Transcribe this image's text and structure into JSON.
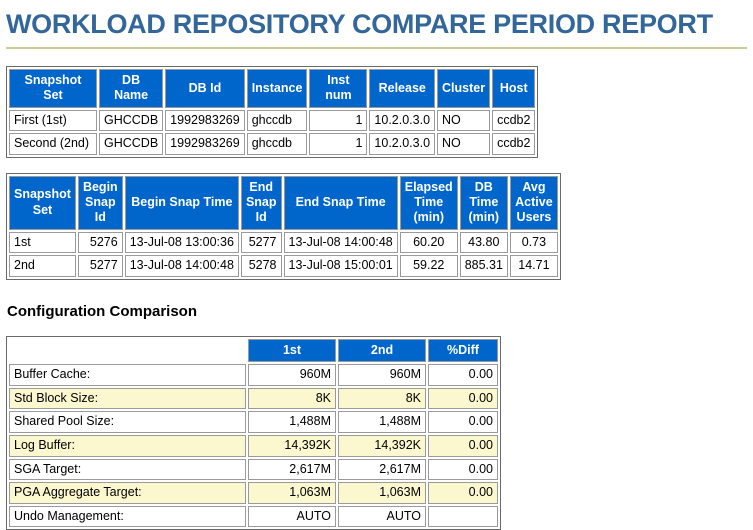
{
  "page": {
    "title": "WORKLOAD REPOSITORY COMPARE PERIOD REPORT"
  },
  "colors": {
    "title_color": "#336699",
    "header_bg": "#0066CC",
    "header_text": "#FFFFFF",
    "alt_row_bg": "#FBF8D0",
    "rule_color": "#CCCC99"
  },
  "tables": {
    "snapshot_info": {
      "headers": [
        "Snapshot Set",
        "DB Name",
        "DB Id",
        "Instance",
        "Inst num",
        "Release",
        "Cluster",
        "Host"
      ],
      "rows": [
        [
          "First (1st)",
          "GHCCDB",
          "1992983269",
          "ghccdb",
          "1",
          "10.2.0.3.0",
          "NO",
          "ccdb2"
        ],
        [
          "Second (2nd)",
          "GHCCDB",
          "1992983269",
          "ghccdb",
          "1",
          "10.2.0.3.0",
          "NO",
          "ccdb2"
        ]
      ]
    },
    "snapshot_details": {
      "headers": [
        "Snapshot Set",
        "Begin Snap Id",
        "Begin Snap Time",
        "End Snap Id",
        "End Snap Time",
        "Elapsed Time (min)",
        "DB Time (min)",
        "Avg Active Users"
      ],
      "rows": [
        [
          "1st",
          "5276",
          "13-Jul-08 13:00:36",
          "5277",
          "13-Jul-08 14:00:48",
          "60.20",
          "43.80",
          "0.73"
        ],
        [
          "2nd",
          "5277",
          "13-Jul-08 14:00:48",
          "5278",
          "13-Jul-08 15:00:01",
          "59.22",
          "885.31",
          "14.71"
        ]
      ]
    },
    "config_comparison": {
      "heading": "Configuration Comparison",
      "headers": [
        "1st",
        "2nd",
        "%Diff"
      ],
      "rows": [
        [
          "Buffer Cache:",
          "960M",
          "960M",
          "0.00"
        ],
        [
          "Std Block Size:",
          "8K",
          "8K",
          "0.00"
        ],
        [
          "Shared Pool Size:",
          "1,488M",
          "1,488M",
          "0.00"
        ],
        [
          "Log Buffer:",
          "14,392K",
          "14,392K",
          "0.00"
        ],
        [
          "SGA Target:",
          "2,617M",
          "2,617M",
          "0.00"
        ],
        [
          "PGA Aggregate Target:",
          "1,063M",
          "1,063M",
          "0.00"
        ],
        [
          "Undo Management:",
          "AUTO",
          "AUTO",
          ""
        ]
      ]
    }
  }
}
